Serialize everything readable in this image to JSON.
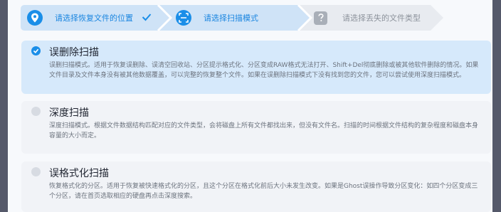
{
  "steps": [
    {
      "label": "请选择恢复文件的位置",
      "icon": "location-pin-icon",
      "state": "done"
    },
    {
      "label": "请选择扫描模式",
      "icon": "scan-icon",
      "state": "current"
    },
    {
      "label": "请选择丢失的文件类型",
      "icon": "question-icon",
      "state": "pending"
    }
  ],
  "options": [
    {
      "title": "误删除扫描",
      "desc": "误删扫描模式。适用于恢复误删除、误清空回收站、分区提示格式化、分区变成RAW格式无法打开、Shift+Del彻底删除或被其他软件删除的情况。如果文件目录及文件本身没有被其他数据覆盖，可以完整的恢复整个文件。如果在误删除扫描模式下没有找到您的文件，您可以尝试使用深度扫描模式。",
      "selected": true
    },
    {
      "title": "深度扫描",
      "desc": "深度扫描模式。根据文件数据结构匹配对应的文件类型，会将磁盘上所有文件都找出来，但没有文件名。扫描的时间根据文件结构的复杂程度和磁盘本身容量的大小而定。",
      "selected": false
    },
    {
      "title": "误格式化扫描",
      "desc": "恢复格式化的分区。适用于恢复被快速格式化的分区，且这个分区在格式化前后大小未发生改变。如果是Ghost误操作导致分区变化：如四个分区变成三个分区，请在首页选取相应的硬盘再点击深度搜索。",
      "selected": false
    }
  ],
  "colors": {
    "accent": "#1a8ee8",
    "selected_card": "#d6e9fb",
    "card": "#f1f3f7"
  }
}
